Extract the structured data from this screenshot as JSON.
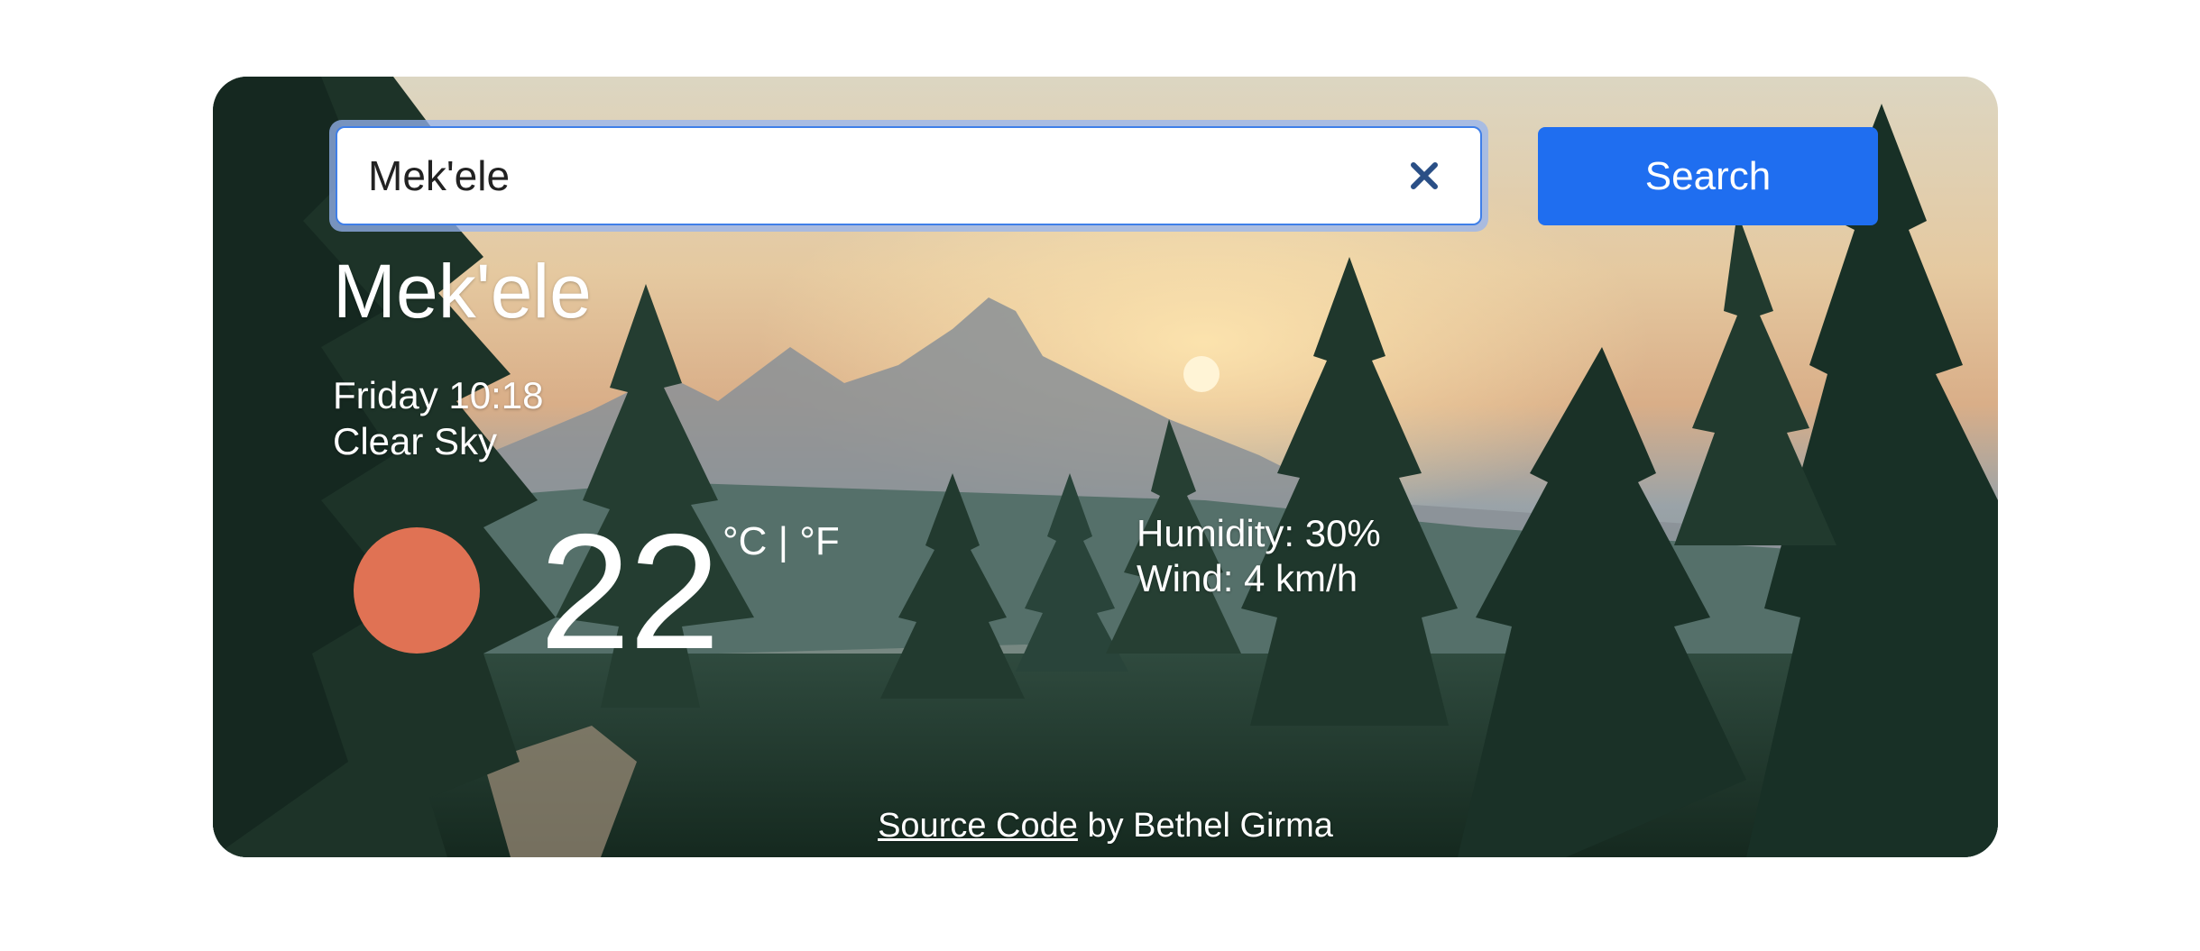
{
  "search": {
    "value": "Mek'ele",
    "button_label": "Search",
    "clear_icon": "close-icon"
  },
  "weather": {
    "city": "Mek'ele",
    "datetime": "Friday 10:18",
    "condition": "Clear Sky",
    "icon": "sun-icon",
    "icon_color": "#e07254",
    "temperature": "22",
    "unit_celsius": "°C",
    "unit_separator": "|",
    "unit_fahrenheit": "°F",
    "humidity": "Humidity: 30%",
    "wind": "Wind: 4 km/h"
  },
  "footer": {
    "link_text": "Source Code",
    "credit": "by Bethel Girma"
  },
  "colors": {
    "button": "#1f6ef0",
    "focus_ring": "#3f7fe8"
  }
}
